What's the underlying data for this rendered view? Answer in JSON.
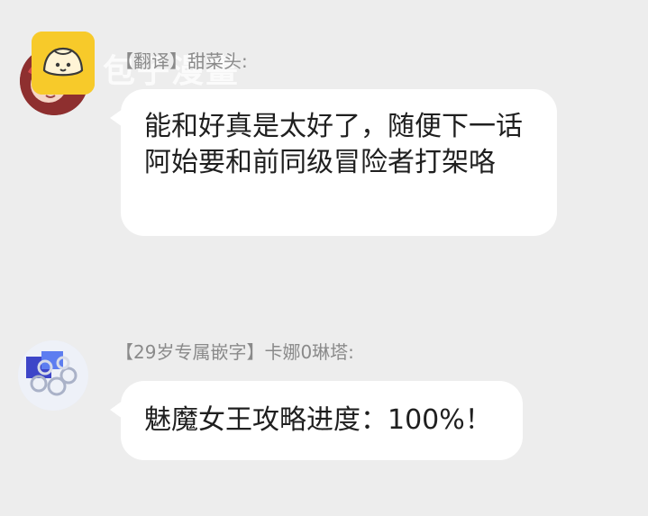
{
  "colors": {
    "background": "#ededed",
    "bubble": "#ffffff",
    "sender_text": "#8a8a8a",
    "message_text": "#1f1f1f",
    "badge": "#f7ca2a"
  },
  "watermark": {
    "text": "包子漫畫"
  },
  "messages": [
    {
      "sender": "【翻译】甜菜头:",
      "text": "能和好真是太好了，随便下一话阿始要和前同级冒险者打架咯",
      "avatar_icon": "anime-girl-avatar-icon",
      "badge_icon": "bun-logo-icon"
    },
    {
      "sender": "【29岁专属嵌字】卡娜0琳塔:",
      "text": "魅魔女王攻略进度：100%！",
      "avatar_icon": "pattern-avatar-icon"
    }
  ]
}
